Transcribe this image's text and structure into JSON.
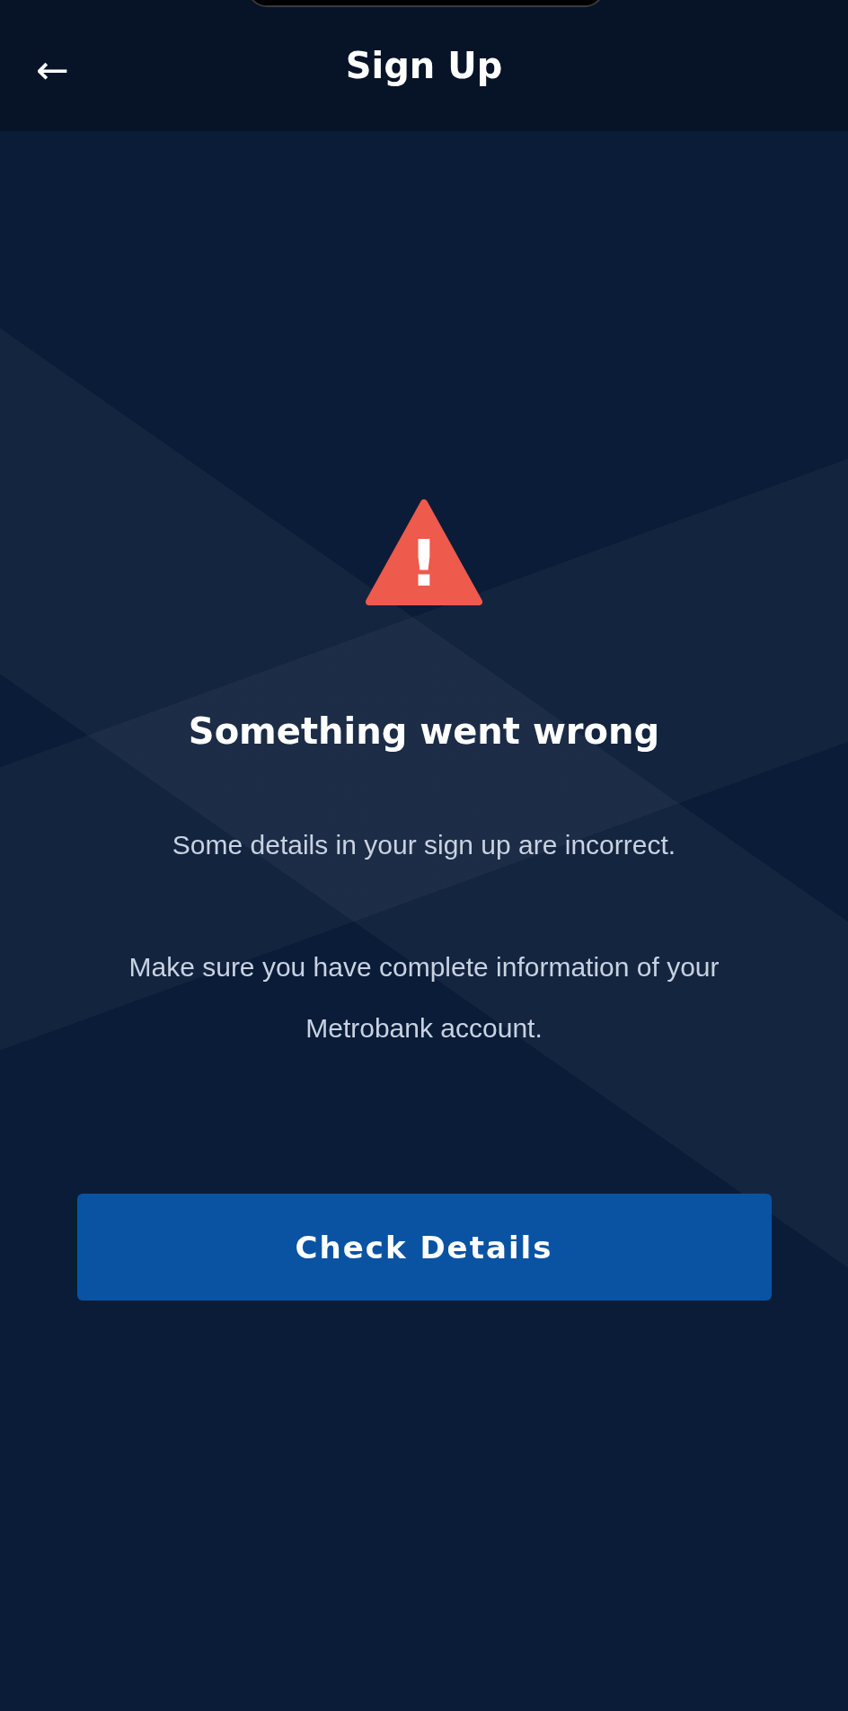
{
  "header": {
    "back": "←",
    "title": "Sign Up"
  },
  "error": {
    "icon": "!",
    "title": "Something went wrong",
    "paragraphs": [
      "Some details in your sign up are incorrect.",
      "Make sure you have complete information of your Metrobank account."
    ]
  },
  "button": {
    "label": "Check Details"
  }
}
